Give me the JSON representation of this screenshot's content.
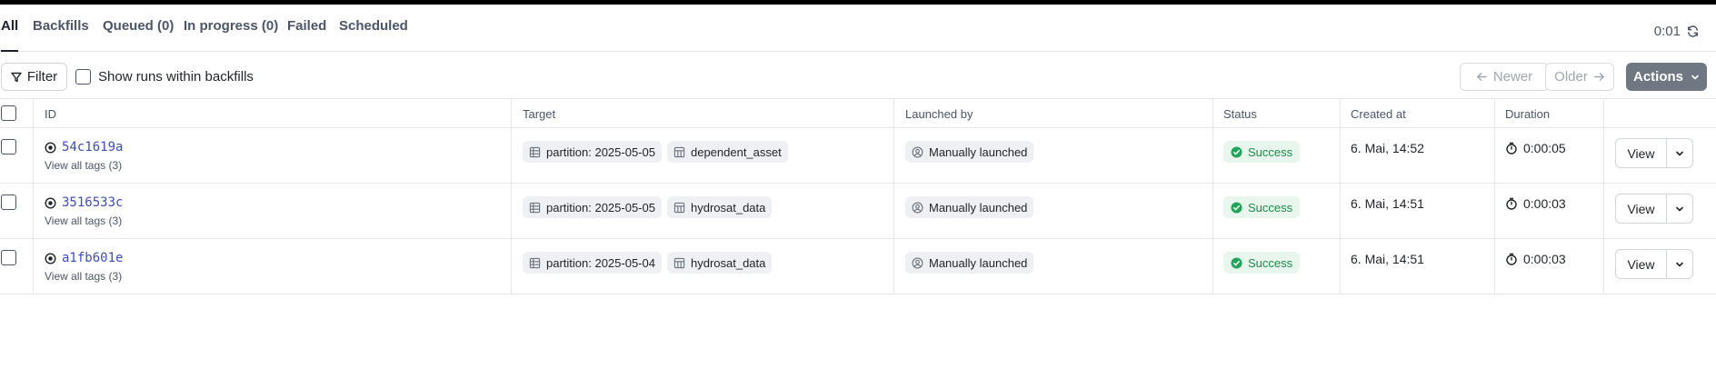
{
  "tabs": [
    {
      "label": "All"
    },
    {
      "label": "Backfills"
    },
    {
      "label": "Queued (0)"
    },
    {
      "label": "In progress (0)"
    },
    {
      "label": "Failed"
    },
    {
      "label": "Scheduled"
    }
  ],
  "refresh": {
    "timer": "0:01"
  },
  "toolbar": {
    "filter_label": "Filter",
    "show_runs_label": "Show runs within backfills",
    "newer_label": "Newer",
    "older_label": "Older",
    "actions_label": "Actions"
  },
  "columns": [
    "ID",
    "Target",
    "Launched by",
    "Status",
    "Created at",
    "Duration"
  ],
  "runs": [
    {
      "id": "54c1619a",
      "tags_link": "View all tags (3)",
      "partition": "partition: 2025-05-05",
      "asset": "dependent_asset",
      "launched_by": "Manually launched",
      "status": "Success",
      "created_at": "6. Mai, 14:52",
      "duration": "0:00:05",
      "view_label": "View"
    },
    {
      "id": "3516533c",
      "tags_link": "View all tags (3)",
      "partition": "partition: 2025-05-05",
      "asset": "hydrosat_data",
      "launched_by": "Manually launched",
      "status": "Success",
      "created_at": "6. Mai, 14:51",
      "duration": "0:00:03",
      "view_label": "View"
    },
    {
      "id": "a1fb601e",
      "tags_link": "View all tags (3)",
      "partition": "partition: 2025-05-04",
      "asset": "hydrosat_data",
      "launched_by": "Manually launched",
      "status": "Success",
      "created_at": "6. Mai, 14:51",
      "duration": "0:00:03",
      "view_label": "View"
    }
  ],
  "colors": {
    "accent": "#3d4db7",
    "success": "#1c8a47",
    "actions_bg": "#6e7782"
  }
}
